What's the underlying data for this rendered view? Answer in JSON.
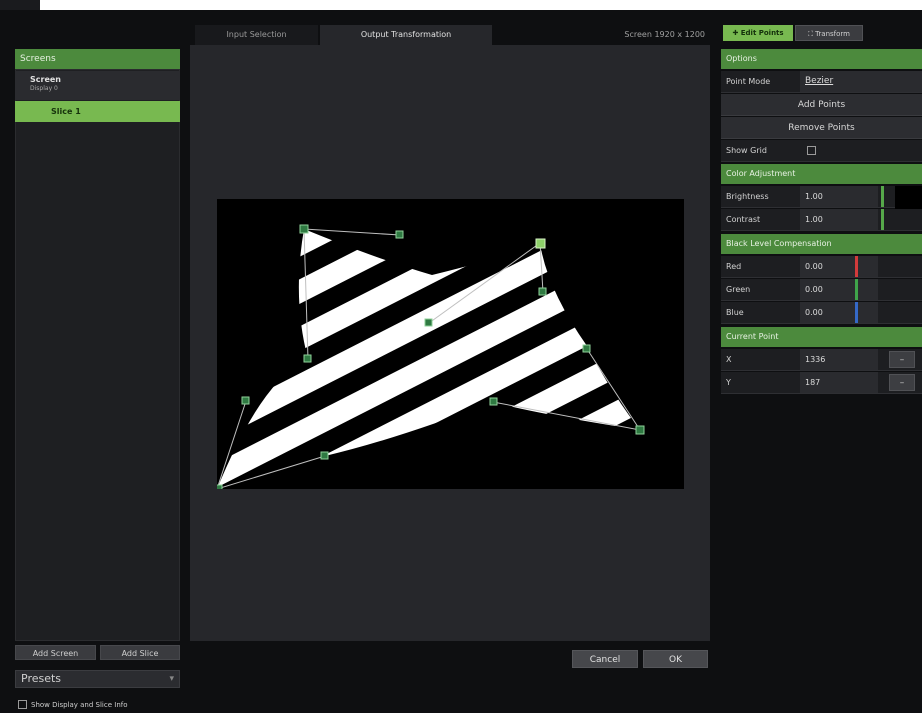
{
  "tabs": {
    "input_selection": "Input Selection",
    "output_transformation": "Output Transformation"
  },
  "resolution": "Screen   1920 x 1200",
  "left": {
    "header": "Screens",
    "screen": {
      "title": "Screen",
      "sub": "Display 0"
    },
    "slice": "Slice 1",
    "add_screen": "Add Screen",
    "add_slice": "Add Slice",
    "presets": "Presets",
    "show_info": "Show Display and Slice Info"
  },
  "dialog": {
    "cancel": "Cancel",
    "ok": "OK"
  },
  "right": {
    "edit_points": "Edit Points",
    "transform": "Transform",
    "options_title": "Options",
    "point_mode_label": "Point Mode",
    "point_mode_value": "Bezier",
    "add_points": "Add Points",
    "remove_points": "Remove Points",
    "show_grid": "Show Grid",
    "color_title": "Color Adjustment",
    "brightness_label": "Brightness",
    "brightness_value": "1.00",
    "contrast_label": "Contrast",
    "contrast_value": "1.00",
    "blc_title": "Black Level Compensation",
    "red_label": "Red",
    "red_value": "0.00",
    "green_label": "Green",
    "green_value": "0.00",
    "blue_label": "Blue",
    "blue_value": "0.00",
    "current_point_title": "Current Point",
    "x_label": "X",
    "x_value": "1336",
    "y_label": "Y",
    "y_value": "187",
    "minus": "–"
  },
  "colors": {
    "accent": "#4c8a3d",
    "accent_bright": "#78b950",
    "red": "#d23b3b",
    "green": "#3fa34a",
    "blue": "#3569c7"
  },
  "icons": [
    "plus-icon",
    "transform-icon",
    "chevron-down-icon",
    "checkbox-icon"
  ]
}
